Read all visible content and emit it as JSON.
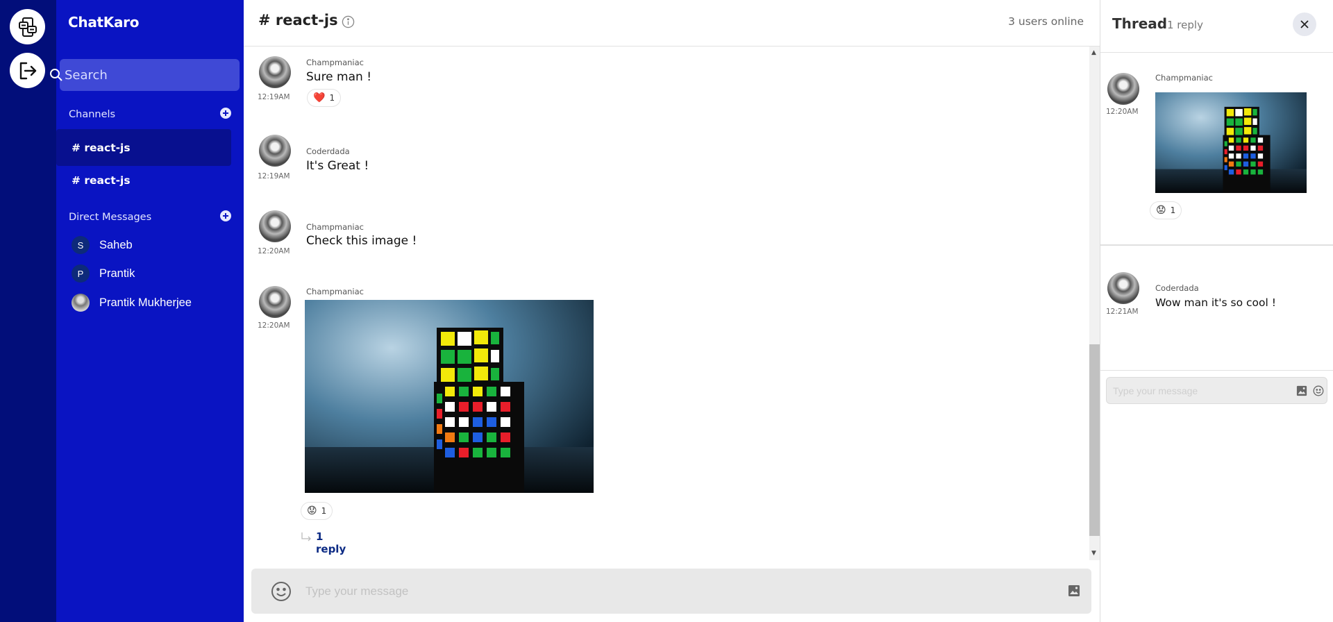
{
  "app": {
    "name": "ChatKaro"
  },
  "search": {
    "placeholder": "Search"
  },
  "sidebar": {
    "channels_title": "Channels",
    "channels": [
      {
        "label": "# react-js",
        "active": true
      },
      {
        "label": "# react-js",
        "active": false
      }
    ],
    "dm_title": "Direct Messages",
    "dms": [
      {
        "initial": "S",
        "name": "Saheb"
      },
      {
        "initial": "P",
        "name": "Prantik"
      },
      {
        "initial": "",
        "name": "Prantik Mukherjee"
      }
    ]
  },
  "header": {
    "channel": "# react-js",
    "online": "3 users online"
  },
  "messages": [
    {
      "author": "Champmaniac",
      "time": "12:19AM",
      "text": "Sure man !",
      "reaction": {
        "emoji": "❤️",
        "count": "1"
      }
    },
    {
      "author": "Coderdada",
      "time": "12:19AM",
      "text": "It's Great !"
    },
    {
      "author": "Champmaniac",
      "time": "12:20AM",
      "text": "Check this image !"
    },
    {
      "author": "Champmaniac",
      "time": "12:20AM",
      "image": "rubiks-cube-photo",
      "reaction": {
        "emoji": "😟",
        "count": "1"
      },
      "replies": "1 reply"
    }
  ],
  "composer": {
    "placeholder": "Type your message"
  },
  "thread": {
    "title": "Thread",
    "count": "1 reply",
    "messages": [
      {
        "author": "Champmaniac",
        "time": "12:20AM",
        "image": "rubiks-cube-photo",
        "reaction": {
          "emoji": "😟",
          "count": "1"
        }
      },
      {
        "author": "Coderdada",
        "time": "12:21AM",
        "text": "Wow man it's so cool !"
      }
    ],
    "composer_placeholder": "Type your message"
  },
  "colors": {
    "rail": "#020e7a",
    "sidebar": "#0a14c2",
    "active_channel": "#08108f",
    "reply_link": "#0b2a84"
  }
}
